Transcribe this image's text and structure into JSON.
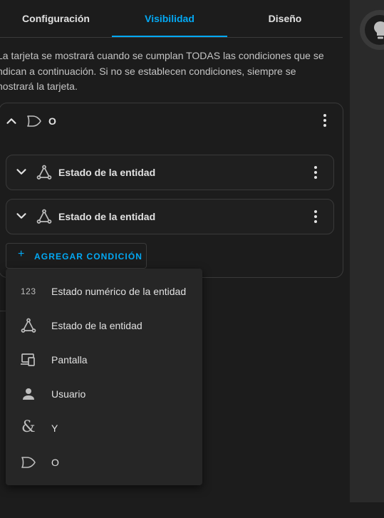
{
  "tabs": [
    {
      "label": "Configuración",
      "active": false
    },
    {
      "label": "Visibilidad",
      "active": true
    },
    {
      "label": "Diseño",
      "active": false
    }
  ],
  "description": "La tarjeta se mostrará cuando se cumplan TODAS las condiciones que se indican a continuación. Si no se establecen condiciones, siempre se mostrará la tarjeta.",
  "description_lines": [
    "La tarjeta se mostrará cuando se cumplan TODAS las condiciones que se",
    "ndican a continuación. Si no se establecen condiciones, siempre se",
    "nostrará la tarjeta."
  ],
  "group": {
    "title": "O",
    "conditions": [
      {
        "label": "Estado de la entidad",
        "icon": "state-icon"
      },
      {
        "label": "Estado de la entidad",
        "icon": "state-icon"
      }
    ],
    "add_button_label": "AGREGAR CONDICIÓN"
  },
  "menu": {
    "items": [
      {
        "label": "Estado numérico de la entidad",
        "icon": "numeric-123-icon",
        "glyph": "123"
      },
      {
        "label": "Estado de la entidad",
        "icon": "state-icon"
      },
      {
        "label": "Pantalla",
        "icon": "screen-icon"
      },
      {
        "label": "Usuario",
        "icon": "user-icon"
      },
      {
        "label": "Y",
        "icon": "and-icon",
        "glyph": "&"
      },
      {
        "label": "O",
        "icon": "or-gate-icon"
      }
    ]
  },
  "colors": {
    "accent": "#03a9f4",
    "background": "#1c1c1c",
    "menu_background": "#262626",
    "border": "#3a3a3a",
    "text": "#e1e1e1"
  }
}
